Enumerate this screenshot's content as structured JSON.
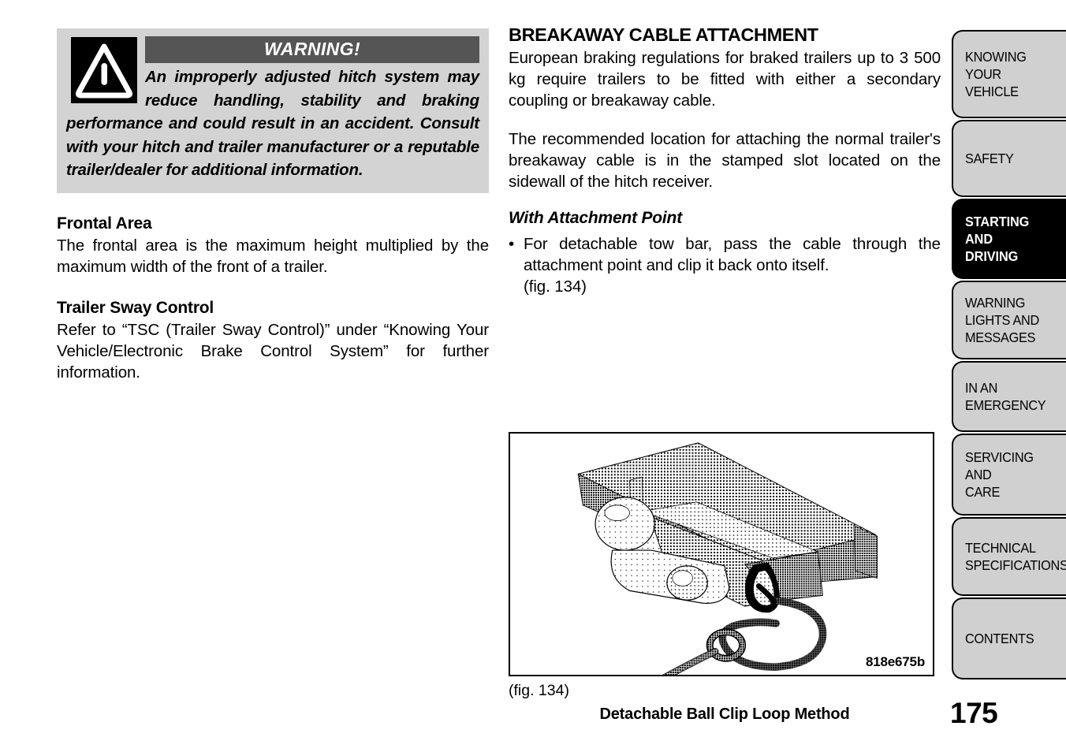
{
  "document": {
    "page_number": "175"
  },
  "warning": {
    "icon": "warning-triangle-icon",
    "banner_label": "WARNING!",
    "text": "An improperly adjusted hitch system may reduce handling, stability and braking performance and could result in an accident. Consult with your hitch and trailer manufacturer or a reputable trailer/dealer for additional information."
  },
  "left_column": {
    "sections": [
      {
        "heading": "Frontal Area",
        "body": "The frontal area is the maximum height multiplied by the maximum width of the front of a trailer."
      },
      {
        "heading": "Trailer Sway Control",
        "body": "Refer to “TSC (Trailer Sway Control)” under “Knowing Your Vehicle/Electronic Brake Control System” for further information."
      }
    ]
  },
  "right_column": {
    "main_heading": "BREAKAWAY CABLE ATTACHMENT",
    "paragraphs": [
      "European braking regulations for braked trailers up to 3 500 kg require trailers to be fitted with either a secondary coupling or breakaway cable.",
      "The recommended location for attaching the normal trailer's breakaway cable is in the stamped slot located on the sidewall of the hitch receiver."
    ],
    "sub_heading": "With Attachment Point",
    "bullet_marker": "•",
    "bullet_text": "For detachable tow bar, pass the cable through the attachment point and clip it back onto itself.",
    "bullet_text_last_line": "(fig. 134)"
  },
  "figure": {
    "id_label": "818e675b",
    "reference": "(fig. 134)",
    "caption": "Detachable Ball Clip Loop Method",
    "illustration": "tow-bar-ball-hitch-with-breakaway-cable-loop"
  },
  "sidebar": {
    "tabs": [
      {
        "label": "KNOWING\nYOUR\nVEHICLE",
        "active": false
      },
      {
        "label": "SAFETY",
        "active": false
      },
      {
        "label": "STARTING\nAND\nDRIVING",
        "active": true
      },
      {
        "label": "WARNING\nLIGHTS AND\nMESSAGES",
        "active": false
      },
      {
        "label": "IN AN\nEMERGENCY",
        "active": false
      },
      {
        "label": "SERVICING\nAND\nCARE",
        "active": false
      },
      {
        "label": "TECHNICAL\nSPECIFICATIONS",
        "active": false
      },
      {
        "label": "CONTENTS",
        "active": false
      }
    ]
  },
  "colors": {
    "warning_banner_bg": "#555555",
    "warning_box_bg": "#d3d3d3",
    "tab_bg": "#d0d0d0",
    "tab_active_bg": "#000000",
    "text": "#000000"
  }
}
